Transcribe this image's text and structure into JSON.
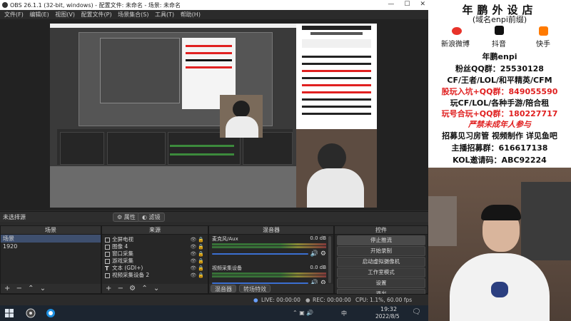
{
  "window": {
    "title": "OBS 26.1.1 (32-bit, windows) - 配置文件: 未命名 - 场景: 未命名"
  },
  "menu": [
    "文件(F)",
    "编辑(E)",
    "视图(V)",
    "配置文件(P)",
    "场景集合(S)",
    "工具(T)",
    "帮助(H)"
  ],
  "status_row": {
    "no_source": "未选择源",
    "properties": "属性",
    "filters": "滤镜"
  },
  "scenes": {
    "header": "场景",
    "items": [
      "场景",
      "1920"
    ]
  },
  "sources": {
    "header": "来源",
    "items": [
      "全屏电视",
      "图像 4",
      "窗口采集",
      "游戏采集",
      "文本 (GDI+)",
      "视频采集设备 2"
    ]
  },
  "mixer": {
    "header": "混音器",
    "tracks": [
      {
        "name": "麦克风/Aux",
        "level": "0.0 dB"
      },
      {
        "name": "视频采集设备",
        "level": "0.0 dB"
      }
    ],
    "tabs": [
      "混音器",
      "转场特效"
    ]
  },
  "controls": {
    "header": "控件",
    "buttons": [
      "停止推流",
      "开始录制",
      "启动虚拟摄像机",
      "工作室模式",
      "设置",
      "退出"
    ]
  },
  "bottom_status": {
    "live": "LIVE: 00:00:00",
    "rec": "REC: 00:00:00",
    "cpu": "CPU: 1.1%, 60.00 fps"
  },
  "taskbar": {
    "time": "19:32",
    "date": "2022/8/5",
    "ime": "中"
  },
  "overlay": {
    "title": "年鹏外设店",
    "subtitle": "(域名enpi前缀)",
    "socials": [
      "新浪微博",
      "抖音",
      "快手"
    ],
    "handle": "年鹏enpi",
    "lines": [
      {
        "text": "粉丝QQ群：25530128",
        "color": "#111111"
      },
      {
        "text": "CF/王者/LOL/和平精英/CFM",
        "color": "#111111"
      },
      {
        "text": "股玩入坑+QQ群：849055590",
        "color": "#e02020"
      },
      {
        "text": "玩CF/LOL/各种手游/陪合租",
        "color": "#111111"
      },
      {
        "text": "玩号合玩+QQ群：180227717",
        "color": "#e02020"
      },
      {
        "text": "严禁未成年人参与",
        "color": "#e02020"
      },
      {
        "text": "招募见习房管 视频制作 详见鱼吧",
        "color": "#111111"
      },
      {
        "text": "主播招募群：616617138",
        "color": "#111111"
      },
      {
        "text": "KOL邀请码：ABC92224",
        "color": "#111111"
      }
    ]
  },
  "colors": {
    "accent": "#3b6fd1",
    "warning_text": "#e02020",
    "selection": "#3e4f6e"
  }
}
